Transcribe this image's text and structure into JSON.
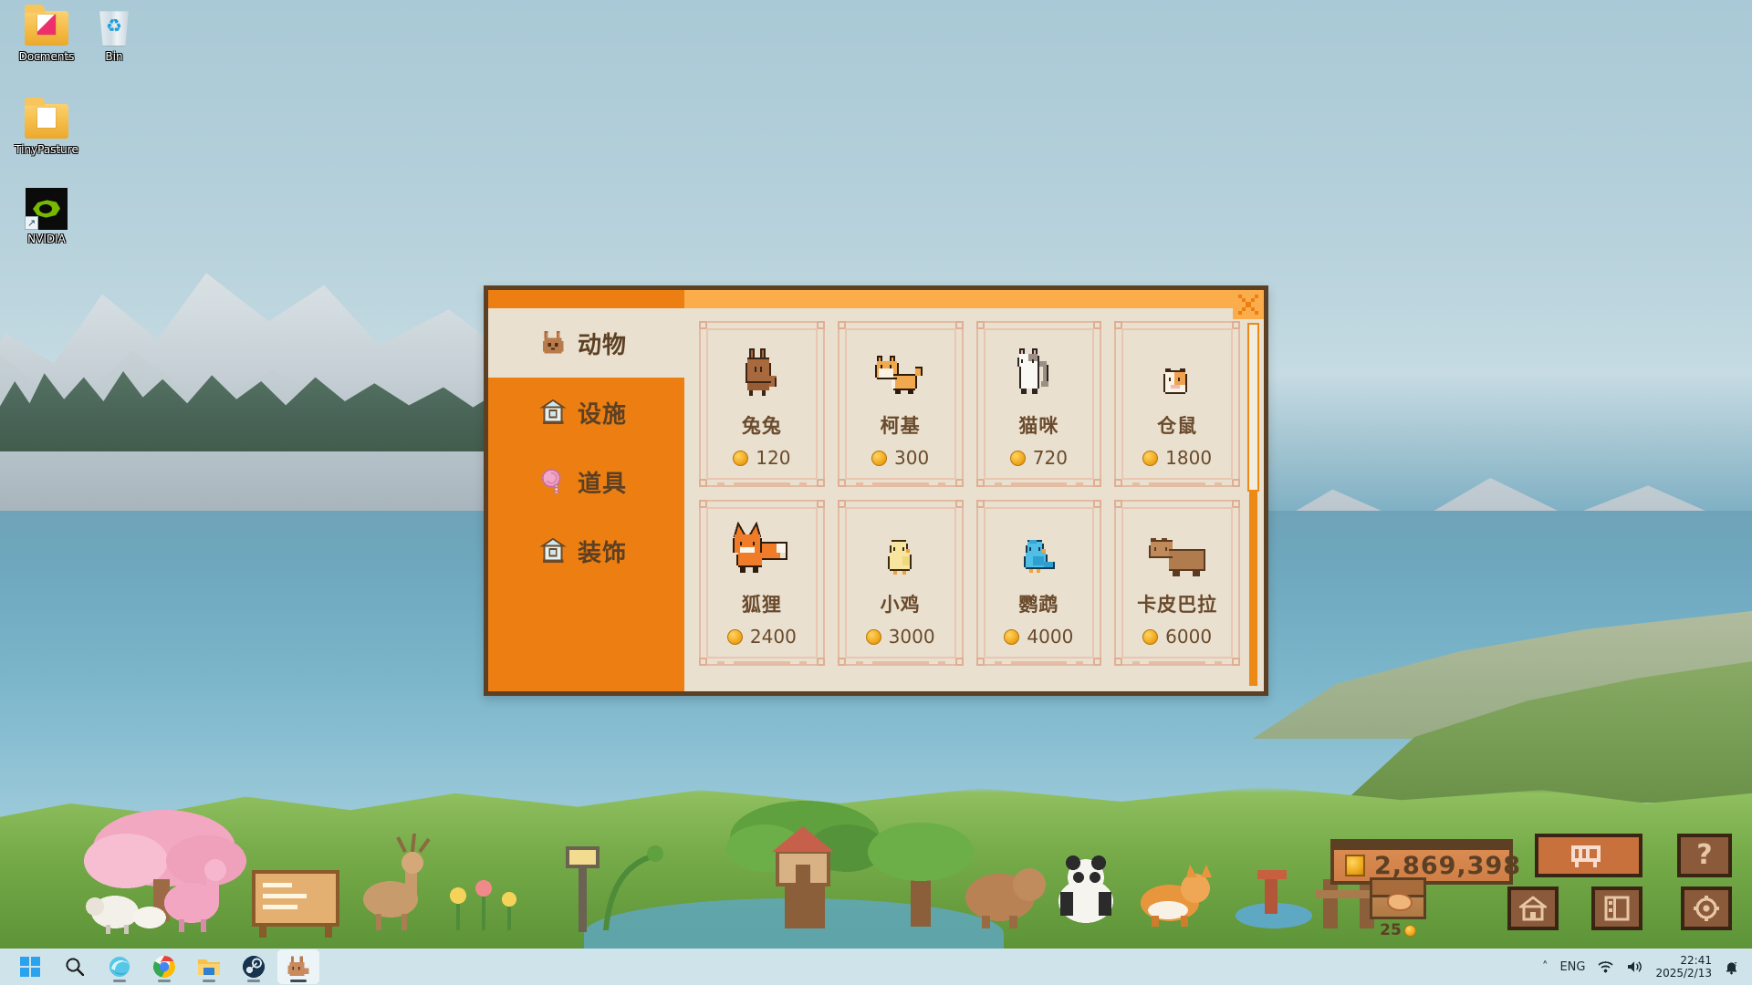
{
  "desktop": {
    "icons": [
      {
        "label": "Docments",
        "icon": "folder-documents-icon"
      },
      {
        "label": "Bin",
        "icon": "recycle-bin-icon"
      },
      {
        "label": "TinyPasture",
        "icon": "folder-icon"
      },
      {
        "label": "NVIDIA",
        "icon": "nvidia-shortcut-icon"
      }
    ]
  },
  "shop": {
    "title_bar": {
      "close_label": "×"
    },
    "sidebar": {
      "items": [
        {
          "label": "动物",
          "icon": "rabbit-icon",
          "active": true
        },
        {
          "label": "设施",
          "icon": "building-icon",
          "active": false
        },
        {
          "label": "道具",
          "icon": "lollipop-icon",
          "active": false
        },
        {
          "label": "装饰",
          "icon": "building-icon",
          "active": false
        }
      ]
    },
    "rows": [
      [
        {
          "name": "兔兔",
          "price": "120",
          "sprite": "rabbit-sprite"
        },
        {
          "name": "柯基",
          "price": "300",
          "sprite": "corgi-sprite"
        },
        {
          "name": "猫咪",
          "price": "720",
          "sprite": "cat-sprite"
        },
        {
          "name": "仓鼠",
          "price": "1800",
          "sprite": "hamster-sprite"
        }
      ],
      [
        {
          "name": "狐狸",
          "price": "2400",
          "sprite": "fox-sprite"
        },
        {
          "name": "小鸡",
          "price": "3000",
          "sprite": "chick-sprite"
        },
        {
          "name": "鹦鹉",
          "price": "4000",
          "sprite": "parrot-sprite"
        },
        {
          "name": "卡皮巴拉",
          "price": "6000",
          "sprite": "capybara-sprite"
        }
      ]
    ]
  },
  "hud": {
    "coins": "2,869,398",
    "chest_count": "25",
    "buttons": {
      "shop": "shop-cart-icon",
      "help": "?",
      "home": "home-icon",
      "book": "journal-icon",
      "settings": "gear-icon"
    }
  },
  "taskbar": {
    "apps": [
      {
        "name": "start-button",
        "icon": "windows-logo-icon",
        "active": false
      },
      {
        "name": "search-button",
        "icon": "search-icon",
        "active": false
      },
      {
        "name": "edge-button",
        "icon": "edge-icon",
        "active": false
      },
      {
        "name": "chrome-button",
        "icon": "chrome-icon",
        "active": false
      },
      {
        "name": "file-explorer-button",
        "icon": "folder-icon",
        "active": false
      },
      {
        "name": "steam-button",
        "icon": "steam-icon",
        "active": false
      },
      {
        "name": "tinypasture-button",
        "icon": "rabbit-icon",
        "active": true
      }
    ],
    "tray": {
      "chevron": "˄",
      "language": "ENG",
      "wifi": "wifi-icon",
      "volume": "speaker-icon",
      "time": "22:41",
      "date": "2025/2/13",
      "notifications": "bell-icon"
    }
  },
  "colors": {
    "accent_orange": "#ed7f12",
    "title_orange": "#fbad4b",
    "panel_cream": "#e9e0cf",
    "border_brown": "#5d4023",
    "text_brown": "#6a4a2c",
    "taskbar": "#cfe3ea"
  }
}
